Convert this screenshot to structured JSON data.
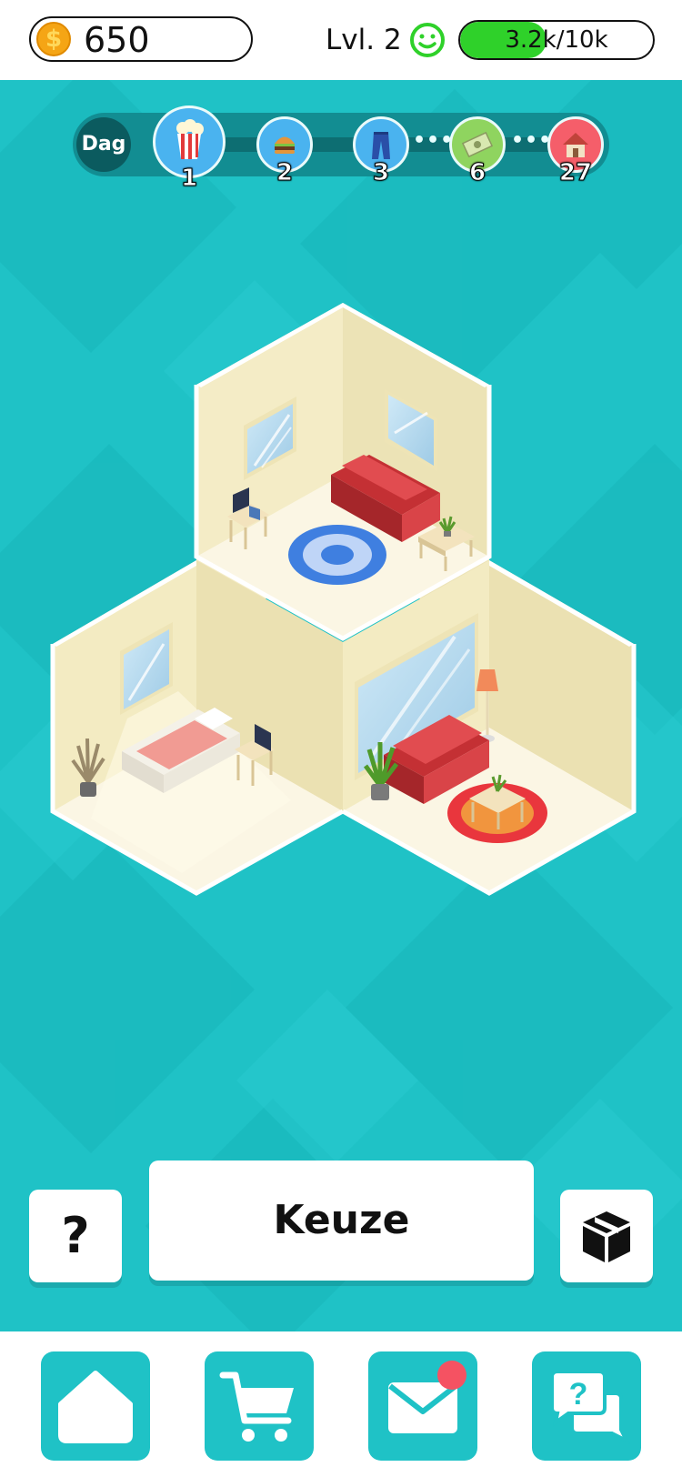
{
  "header": {
    "coins": "650",
    "coin_symbol": "$",
    "level": "Lvl. 2",
    "xp_text": "3.2k/10k",
    "xp_progress": 0.45,
    "mood_icon": "smiley-face-icon"
  },
  "timeline": {
    "label": "Dag",
    "nodes": [
      {
        "icon": "popcorn-icon",
        "number": "1",
        "color": "#4ab3ef"
      },
      {
        "icon": "burger-icon",
        "number": "2",
        "color": "#4ab3ef"
      },
      {
        "icon": "jeans-icon",
        "number": "3",
        "color": "#4ab3ef"
      },
      {
        "icon": "money-icon",
        "number": "6",
        "color": "#8fd45f"
      },
      {
        "icon": "house-icon",
        "number": "27",
        "color": "#f55e6a"
      }
    ],
    "separator": "•••"
  },
  "actions": {
    "help_label": "?",
    "choice_label": "Keuze",
    "box_icon": "package-box-icon"
  },
  "nav": {
    "items": [
      {
        "icon": "home-icon"
      },
      {
        "icon": "cart-icon"
      },
      {
        "icon": "mail-icon",
        "has_badge": true
      },
      {
        "icon": "chat-help-icon"
      }
    ]
  },
  "colors": {
    "teal": "#1fc2c6",
    "xp_green": "#2fd12a",
    "badge_red": "#f55262",
    "sofa_red": "#d63a3e",
    "wall_cream": "#f3ecc4"
  }
}
